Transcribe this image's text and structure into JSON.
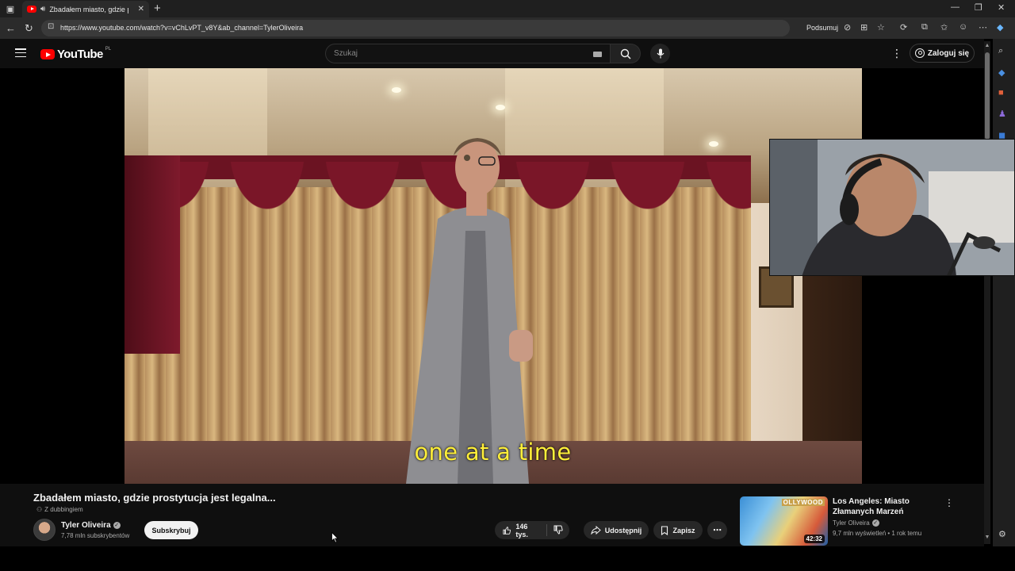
{
  "browser": {
    "tab_title": "Zbadałem miasto, gdzie prostytucja jest legalna...",
    "url": "https://www.youtube.com/watch?v=vChLvPT_v8Y&ab_channel=TylerOliveira",
    "summarize_label": "Podsumuj"
  },
  "youtube": {
    "logo_text": "YouTube",
    "country_code": "PL",
    "search_placeholder": "Szukaj",
    "signin_label": "Zaloguj się"
  },
  "video": {
    "subtitle": "one at a time",
    "title": "Zbadałem miasto, gdzie prostytucja jest legalna...",
    "dub_label": "Z dubbingiem",
    "channel_name": "Tyler Oliveira",
    "subscribers": "7,78 mln subskrybentów",
    "subscribe_label": "Subskrybuj",
    "likes": "146 tys.",
    "share_label": "Udostępnij",
    "save_label": "Zapisz"
  },
  "recommended": [
    {
      "title": "Los Angeles: Miasto Złamanych Marzeń",
      "channel": "Tyler Oliveira",
      "meta": "9,7 mln wyświetleń • 1 rok temu",
      "duration": "42:32",
      "thumb_text": "OLLYWOOD"
    }
  ],
  "colors": {
    "youtube_red": "#ff0000",
    "subtitle_yellow": "#ffef3a",
    "background": "#0f0f0f"
  }
}
